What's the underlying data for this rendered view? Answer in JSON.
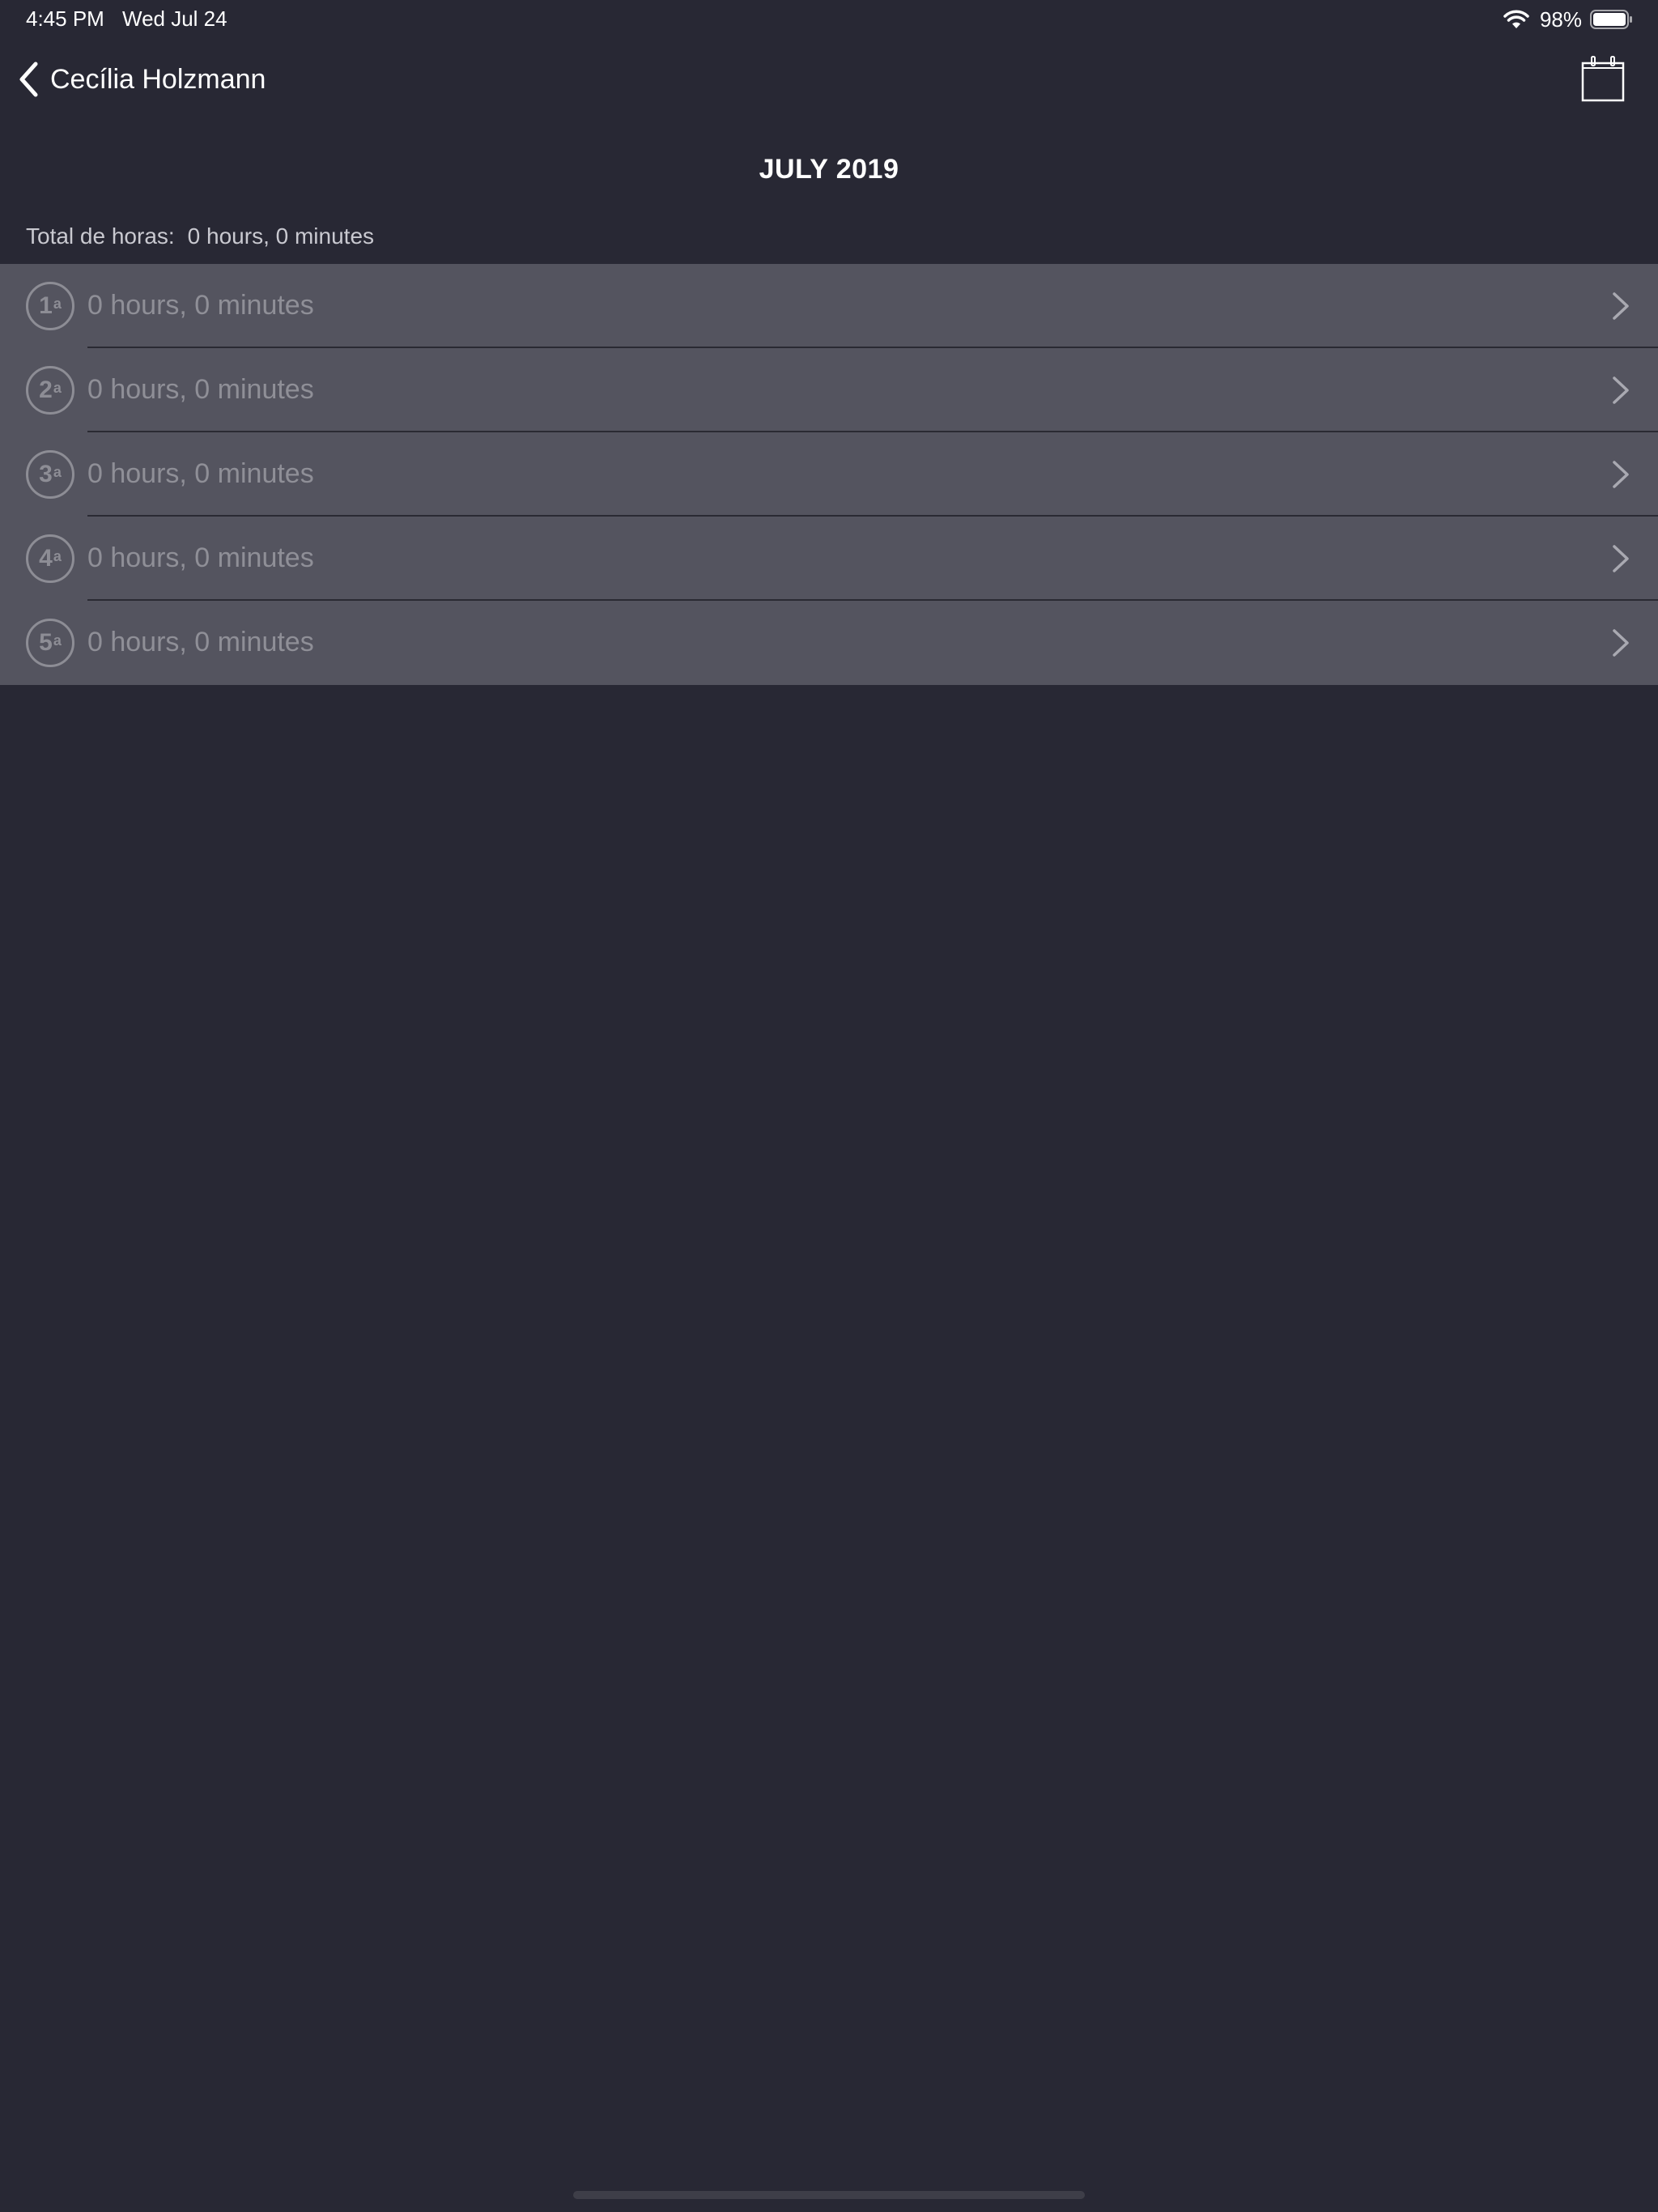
{
  "status_bar": {
    "time": "4:45 PM",
    "date": "Wed Jul 24",
    "battery": "98%",
    "wifi_icon": "wifi-icon",
    "battery_icon": "battery-icon"
  },
  "nav": {
    "back_label": "Cecília Holzmann",
    "back_icon": "chevron-left-icon",
    "calendar_icon": "calendar-icon"
  },
  "month_title": "JULY 2019",
  "total": {
    "label": "Total de horas:",
    "value": "0 hours, 0 minutes"
  },
  "weeks": [
    {
      "badge": "1",
      "ordinal": "a",
      "hours": "0 hours, 0 minutes"
    },
    {
      "badge": "2",
      "ordinal": "a",
      "hours": "0 hours, 0 minutes"
    },
    {
      "badge": "3",
      "ordinal": "a",
      "hours": "0 hours, 0 minutes"
    },
    {
      "badge": "4",
      "ordinal": "a",
      "hours": "0 hours, 0 minutes"
    },
    {
      "badge": "5",
      "ordinal": "a",
      "hours": "0 hours, 0 minutes"
    }
  ],
  "colors": {
    "background": "#282834",
    "row_background": "#54545f",
    "muted_text": "#8f8f97"
  }
}
